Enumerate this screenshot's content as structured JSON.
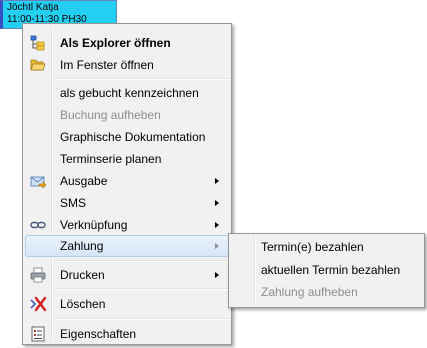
{
  "appointment": {
    "name": "Jöchtl Katja",
    "details": "11:00-11:30 PH30"
  },
  "menu": {
    "open_explorer": "Als Explorer öffnen",
    "open_window": "Im Fenster öffnen",
    "mark_booked": "als gebucht kennzeichnen",
    "cancel_booking": "Buchung aufheben",
    "graphic_documentation": "Graphische Dokumentation",
    "plan_series": "Terminserie planen",
    "output": "Ausgabe",
    "sms": "SMS",
    "link": "Verknüpfung",
    "payment": "Zahlung",
    "print": "Drucken",
    "delete": "Löschen",
    "properties": "Eigenschaften"
  },
  "submenu": {
    "pay_appointments": "Termin(e) bezahlen",
    "pay_current": "aktuellen Termin bezahlen",
    "cancel_payment": "Zahlung aufheben"
  }
}
